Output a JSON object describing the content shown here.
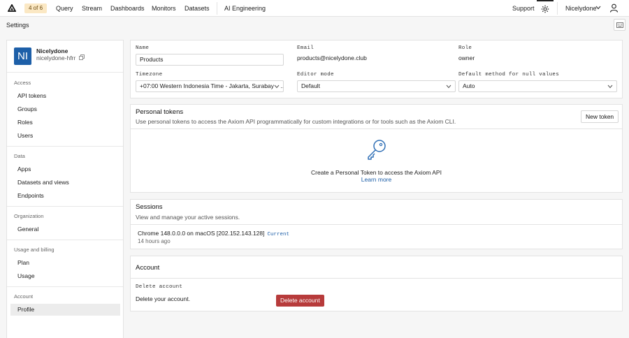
{
  "nav": {
    "badge": "4 of 6",
    "items": [
      "Query",
      "Stream",
      "Dashboards",
      "Monitors",
      "Datasets",
      "AI Engineering"
    ],
    "support": "Support",
    "org": "Nicelydone"
  },
  "settings": {
    "title": "Settings"
  },
  "sidebar": {
    "avatar": "NI",
    "account_name": "Nicelydone",
    "account_id": "nicelydone-hfrr",
    "sections": [
      {
        "heading": "Access",
        "items": [
          "API tokens",
          "Groups",
          "Roles",
          "Users"
        ]
      },
      {
        "heading": "Data",
        "items": [
          "Apps",
          "Datasets and views",
          "Endpoints"
        ]
      },
      {
        "heading": "Organization",
        "items": [
          "General"
        ]
      },
      {
        "heading": "Usage and billing",
        "items": [
          "Plan",
          "Usage"
        ]
      },
      {
        "heading": "Account",
        "items": [
          "Profile"
        ]
      }
    ],
    "active": "Profile"
  },
  "profile": {
    "name_label": "Name",
    "name_value": "Products",
    "email_label": "Email",
    "email_value": "products@nicelydone.club",
    "role_label": "Role",
    "role_value": "owner",
    "timezone_label": "Timezone",
    "timezone_value": "+07:00 Western Indonesia Time - Jakarta, Surabaya, ...",
    "editor_label": "Editor mode",
    "editor_value": "Default",
    "null_label": "Default method for null values",
    "null_value": "Auto"
  },
  "tokens": {
    "title": "Personal tokens",
    "subtitle": "Use personal tokens to access the Axiom API programmatically for custom integrations or for tools such as the Axiom CLI.",
    "new_button": "New token",
    "empty_text": "Create a Personal Token to access the Axiom API",
    "learn_more": "Learn more",
    "icon": "key-icon"
  },
  "sessions": {
    "title": "Sessions",
    "subtitle": "View and manage your active sessions.",
    "session_name": "Chrome 148.0.0.0 on macOS [202.152.143.128]",
    "current_tag": "Current",
    "session_time": "14 hours ago"
  },
  "account": {
    "title": "Account",
    "delete_label": "Delete account",
    "delete_desc": "Delete your account.",
    "delete_button": "Delete account",
    "danger_color": "#b73b3b"
  }
}
